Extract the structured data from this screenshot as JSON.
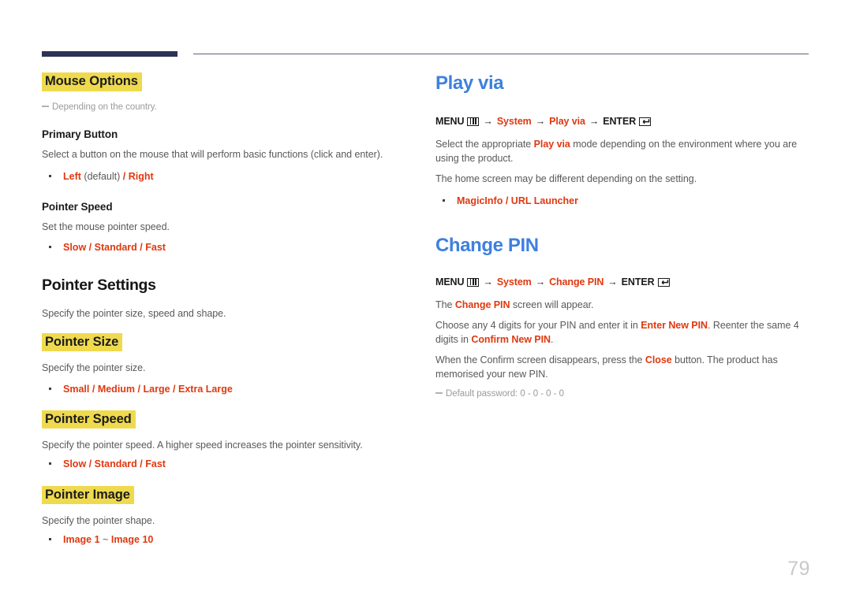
{
  "page": {
    "number": "79"
  },
  "left_column": {
    "mouse_options": {
      "heading": "Mouse Options",
      "note": "Depending on the country.",
      "primary_button": {
        "heading": "Primary Button",
        "description": "Select a button on the mouse that will perform basic functions (click and enter).",
        "option_1": "Left",
        "option_1_suffix": "(default)",
        "separator_1": "/",
        "option_2": "Right"
      },
      "pointer_speed": {
        "heading": "Pointer Speed",
        "description": "Set the mouse pointer speed.",
        "option_1": "Slow",
        "separator_1": "/",
        "option_2": "Standard",
        "separator_2": "/",
        "option_3": "Fast"
      }
    },
    "pointer_settings": {
      "heading": "Pointer Settings",
      "description": "Specify the pointer size, speed and shape.",
      "pointer_size": {
        "heading": "Pointer Size",
        "description": "Specify the pointer size.",
        "option_1": "Small",
        "separator_1": "/",
        "option_2": "Medium",
        "separator_2": "/",
        "option_3": "Large",
        "separator_3": "/",
        "option_4": "Extra Large"
      },
      "pointer_speed": {
        "heading": "Pointer Speed",
        "description": "Specify the pointer speed. A higher speed increases the pointer sensitivity.",
        "option_1": "Slow",
        "separator_1": "/",
        "option_2": "Standard",
        "separator_2": "/",
        "option_3": "Fast"
      },
      "pointer_image": {
        "heading": "Pointer Image",
        "description": "Specify the pointer shape.",
        "option_1": "Image 1",
        "range_sep": "~",
        "option_2": "Image 10"
      }
    }
  },
  "right_column": {
    "play_via": {
      "heading": "Play via",
      "menu_path": {
        "menu_label": "MENU",
        "menu_icon": "menu-grid-icon",
        "arrow": "→",
        "step_1": "System",
        "step_2": "Play via",
        "enter_label": "ENTER",
        "enter_icon": "enter-return-icon"
      },
      "paragraph_1_pre": "Select the appropriate ",
      "paragraph_1_bold": "Play via",
      "paragraph_1_post": " mode depending on the environment where you are using the product.",
      "paragraph_2": "The home screen may be different depending on the setting.",
      "option_1": "MagicInfo",
      "separator_1": "/",
      "option_2": "URL Launcher"
    },
    "change_pin": {
      "heading": "Change PIN",
      "menu_path": {
        "menu_label": "MENU",
        "menu_icon": "menu-grid-icon",
        "arrow": "→",
        "step_1": "System",
        "step_2": "Change PIN",
        "enter_label": "ENTER",
        "enter_icon": "enter-return-icon"
      },
      "paragraph_1_pre": "The ",
      "paragraph_1_bold": "Change PIN",
      "paragraph_1_post": " screen will appear.",
      "paragraph_2_pre": "Choose any 4 digits for your PIN and enter it in ",
      "paragraph_2_bold_1": "Enter New PIN",
      "paragraph_2_mid": ". Reenter the same 4 digits in ",
      "paragraph_2_bold_2": "Confirm New PIN",
      "paragraph_2_post": ".",
      "paragraph_3_pre": "When the Confirm screen disappears, press the ",
      "paragraph_3_bold": "Close",
      "paragraph_3_post": " button. The product has memorised your new PIN.",
      "note": "Default password: 0 - 0 - 0 - 0"
    }
  },
  "colors": {
    "accent_blue": "#3e80df",
    "accent_red": "#e0380f",
    "highlight_yellow": "#efda4e",
    "rule_navy": "#2c3354",
    "body_gray": "#59595b",
    "page_number_gray": "#c9c9cb"
  }
}
